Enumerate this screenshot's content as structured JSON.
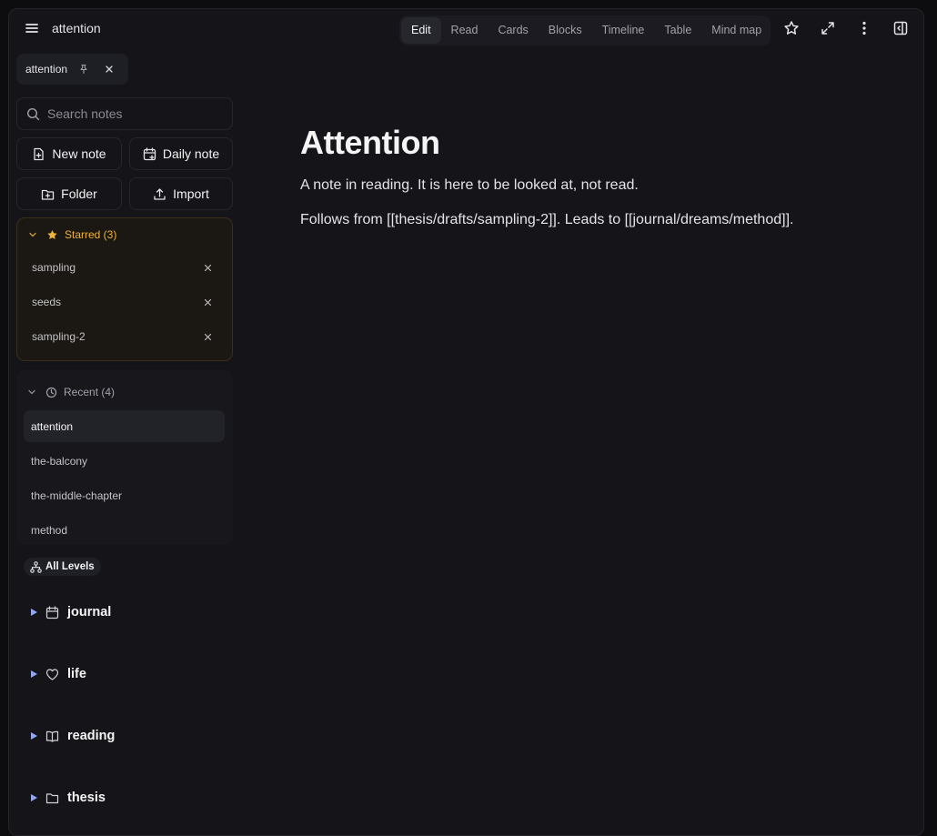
{
  "header": {
    "title": "attention",
    "view_tabs": [
      {
        "label": "Edit",
        "active": true
      },
      {
        "label": "Read",
        "active": false
      },
      {
        "label": "Cards",
        "active": false
      },
      {
        "label": "Blocks",
        "active": false
      },
      {
        "label": "Timeline",
        "active": false
      },
      {
        "label": "Table",
        "active": false
      },
      {
        "label": "Mind map",
        "active": false
      }
    ],
    "icons": [
      "menu-icon",
      "star-icon",
      "expand-icon",
      "more-vertical-icon",
      "sidebar-toggle-icon"
    ]
  },
  "open_tab": {
    "label": "attention",
    "icons": [
      "pin-icon",
      "close-icon"
    ]
  },
  "sidebar": {
    "search": {
      "placeholder": "Search notes",
      "value": ""
    },
    "actions": {
      "new_note": "New note",
      "daily_note": "Daily note",
      "folder": "Folder",
      "import": "Import"
    },
    "starred": {
      "label": "Starred (3)",
      "accent": "#f0b43c",
      "items": [
        {
          "label": "sampling"
        },
        {
          "label": "seeds"
        },
        {
          "label": "sampling-2"
        }
      ]
    },
    "recent": {
      "label": "Recent (4)",
      "items": [
        {
          "label": "attention",
          "active": true
        },
        {
          "label": "the-balcony",
          "active": false
        },
        {
          "label": "the-middle-chapter",
          "active": false
        },
        {
          "label": "method",
          "active": false
        }
      ]
    },
    "levels_filter": "All Levels",
    "folders": [
      {
        "label": "journal",
        "icon": "calendar-icon"
      },
      {
        "label": "life",
        "icon": "heart-icon"
      },
      {
        "label": "reading",
        "icon": "book-icon"
      },
      {
        "label": "thesis",
        "icon": "folder-icon"
      }
    ]
  },
  "note": {
    "title": "Attention",
    "paragraphs": [
      "A note in reading. It is here to be looked at, not read.",
      "Follows from [[thesis/drafts/sampling-2]]. Leads to [[journal/dreams/method]]."
    ]
  }
}
